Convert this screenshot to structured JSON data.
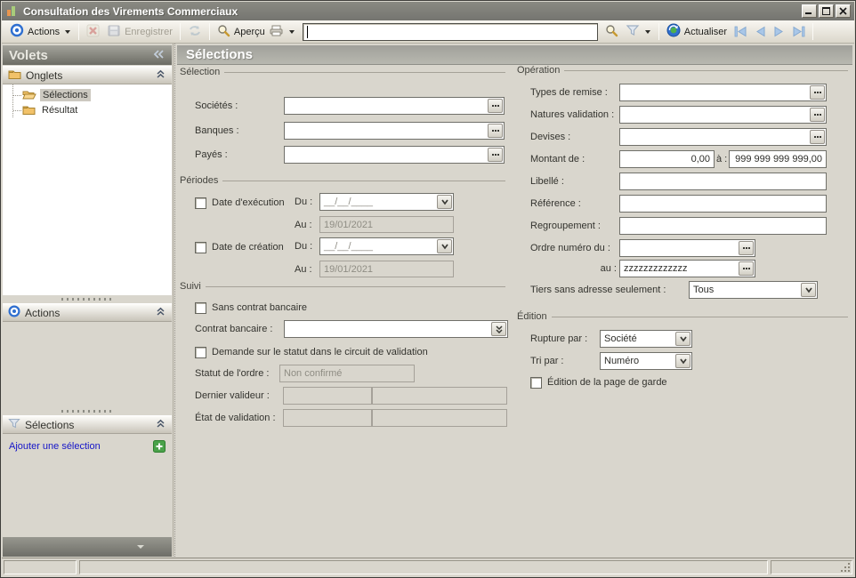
{
  "window": {
    "title": "Consultation des Virements Commerciaux"
  },
  "toolbar": {
    "actions": "Actions",
    "enregistrer": "Enregistrer",
    "apercu": "Aperçu",
    "search_value": "",
    "actualiser": "Actualiser"
  },
  "sidebar": {
    "title": "Volets",
    "onglets": {
      "label": "Onglets",
      "items": [
        {
          "label": "Sélections"
        },
        {
          "label": "Résultat"
        }
      ]
    },
    "actions_label": "Actions",
    "selections_label": "Sélections",
    "add_selection": "Ajouter une sélection"
  },
  "main": {
    "title": "Sélections",
    "selection": {
      "legend": "Sélection",
      "societes": "Sociétés :",
      "banques": "Banques :",
      "payes": "Payés :"
    },
    "periodes": {
      "legend": "Périodes",
      "exec_label": "Date d'exécution",
      "creation_label": "Date de création",
      "du": "Du :",
      "au": "Au :",
      "du_mask": "__/__/____",
      "exec_au": "19/01/2021",
      "creation_au": "19/01/2021"
    },
    "suivi": {
      "legend": "Suivi",
      "sans_contrat": "Sans contrat bancaire",
      "contrat": "Contrat bancaire :",
      "demande": "Demande sur le statut dans le circuit de validation",
      "statut": "Statut de l'ordre :",
      "statut_value": "Non confirmé",
      "dernier": "Dernier valideur :",
      "etat": "État de validation :"
    },
    "operation": {
      "legend": "Opération",
      "types": "Types de remise :",
      "natures": "Natures validation :",
      "devises": "Devises :",
      "montant": "Montant de :",
      "montant_min": "0,00",
      "a": "à :",
      "montant_max": "999 999 999 999,00",
      "libelle": "Libellé :",
      "reference": "Référence :",
      "regroupement": "Regroupement :",
      "ordre_du": "Ordre numéro du :",
      "au": "au :",
      "ordre_au_value": "zzzzzzzzzzzzz",
      "tiers": "Tiers sans adresse seulement :",
      "tiers_value": "Tous"
    },
    "edition": {
      "legend": "Édition",
      "rupture": "Rupture par :",
      "rupture_value": "Société",
      "tri": "Tri par :",
      "tri_value": "Numéro",
      "page_garde": "Édition de la page de garde"
    }
  },
  "colors": {
    "titlebar_gray": "#7d7d75",
    "link_blue": "#1515c8",
    "add_green": "#4aa24a",
    "accent_blue": "#2f6fd0"
  }
}
